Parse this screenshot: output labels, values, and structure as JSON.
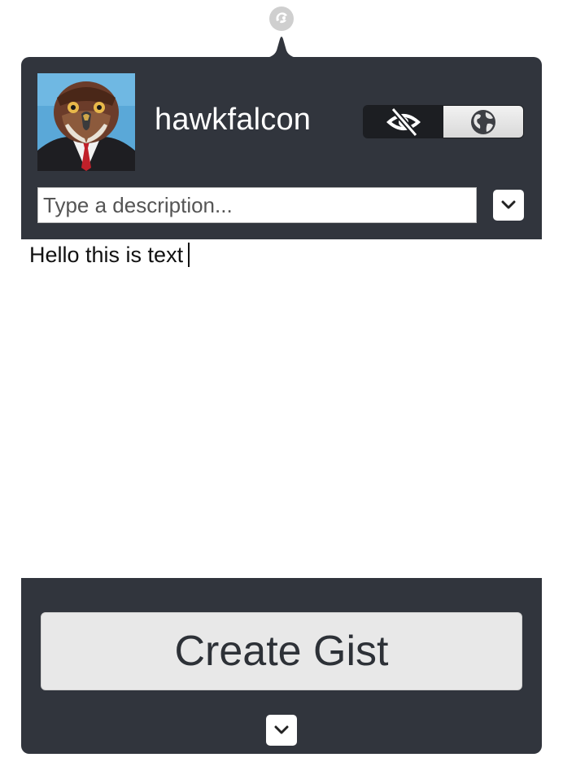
{
  "app": {
    "menubar_icon": "gist-octocat-icon"
  },
  "header": {
    "username": "hawkfalcon",
    "avatar_icon": "hawk-avatar-image",
    "visibility": {
      "options": [
        {
          "name": "secret",
          "icon": "eye-slash-icon",
          "selected": true
        },
        {
          "name": "public",
          "icon": "globe-icon",
          "selected": false
        }
      ]
    },
    "description": {
      "value": "",
      "placeholder": "Type a description..."
    },
    "description_dropdown_icon": "chevron-down-icon"
  },
  "editor": {
    "content": "Hello this is text"
  },
  "footer": {
    "create_label": "Create Gist",
    "dropdown_icon": "chevron-down-icon"
  },
  "colors": {
    "panel_dark": "#31353d",
    "segment_selected": "#1c1e22",
    "button_bg": "#e8e8e8"
  }
}
